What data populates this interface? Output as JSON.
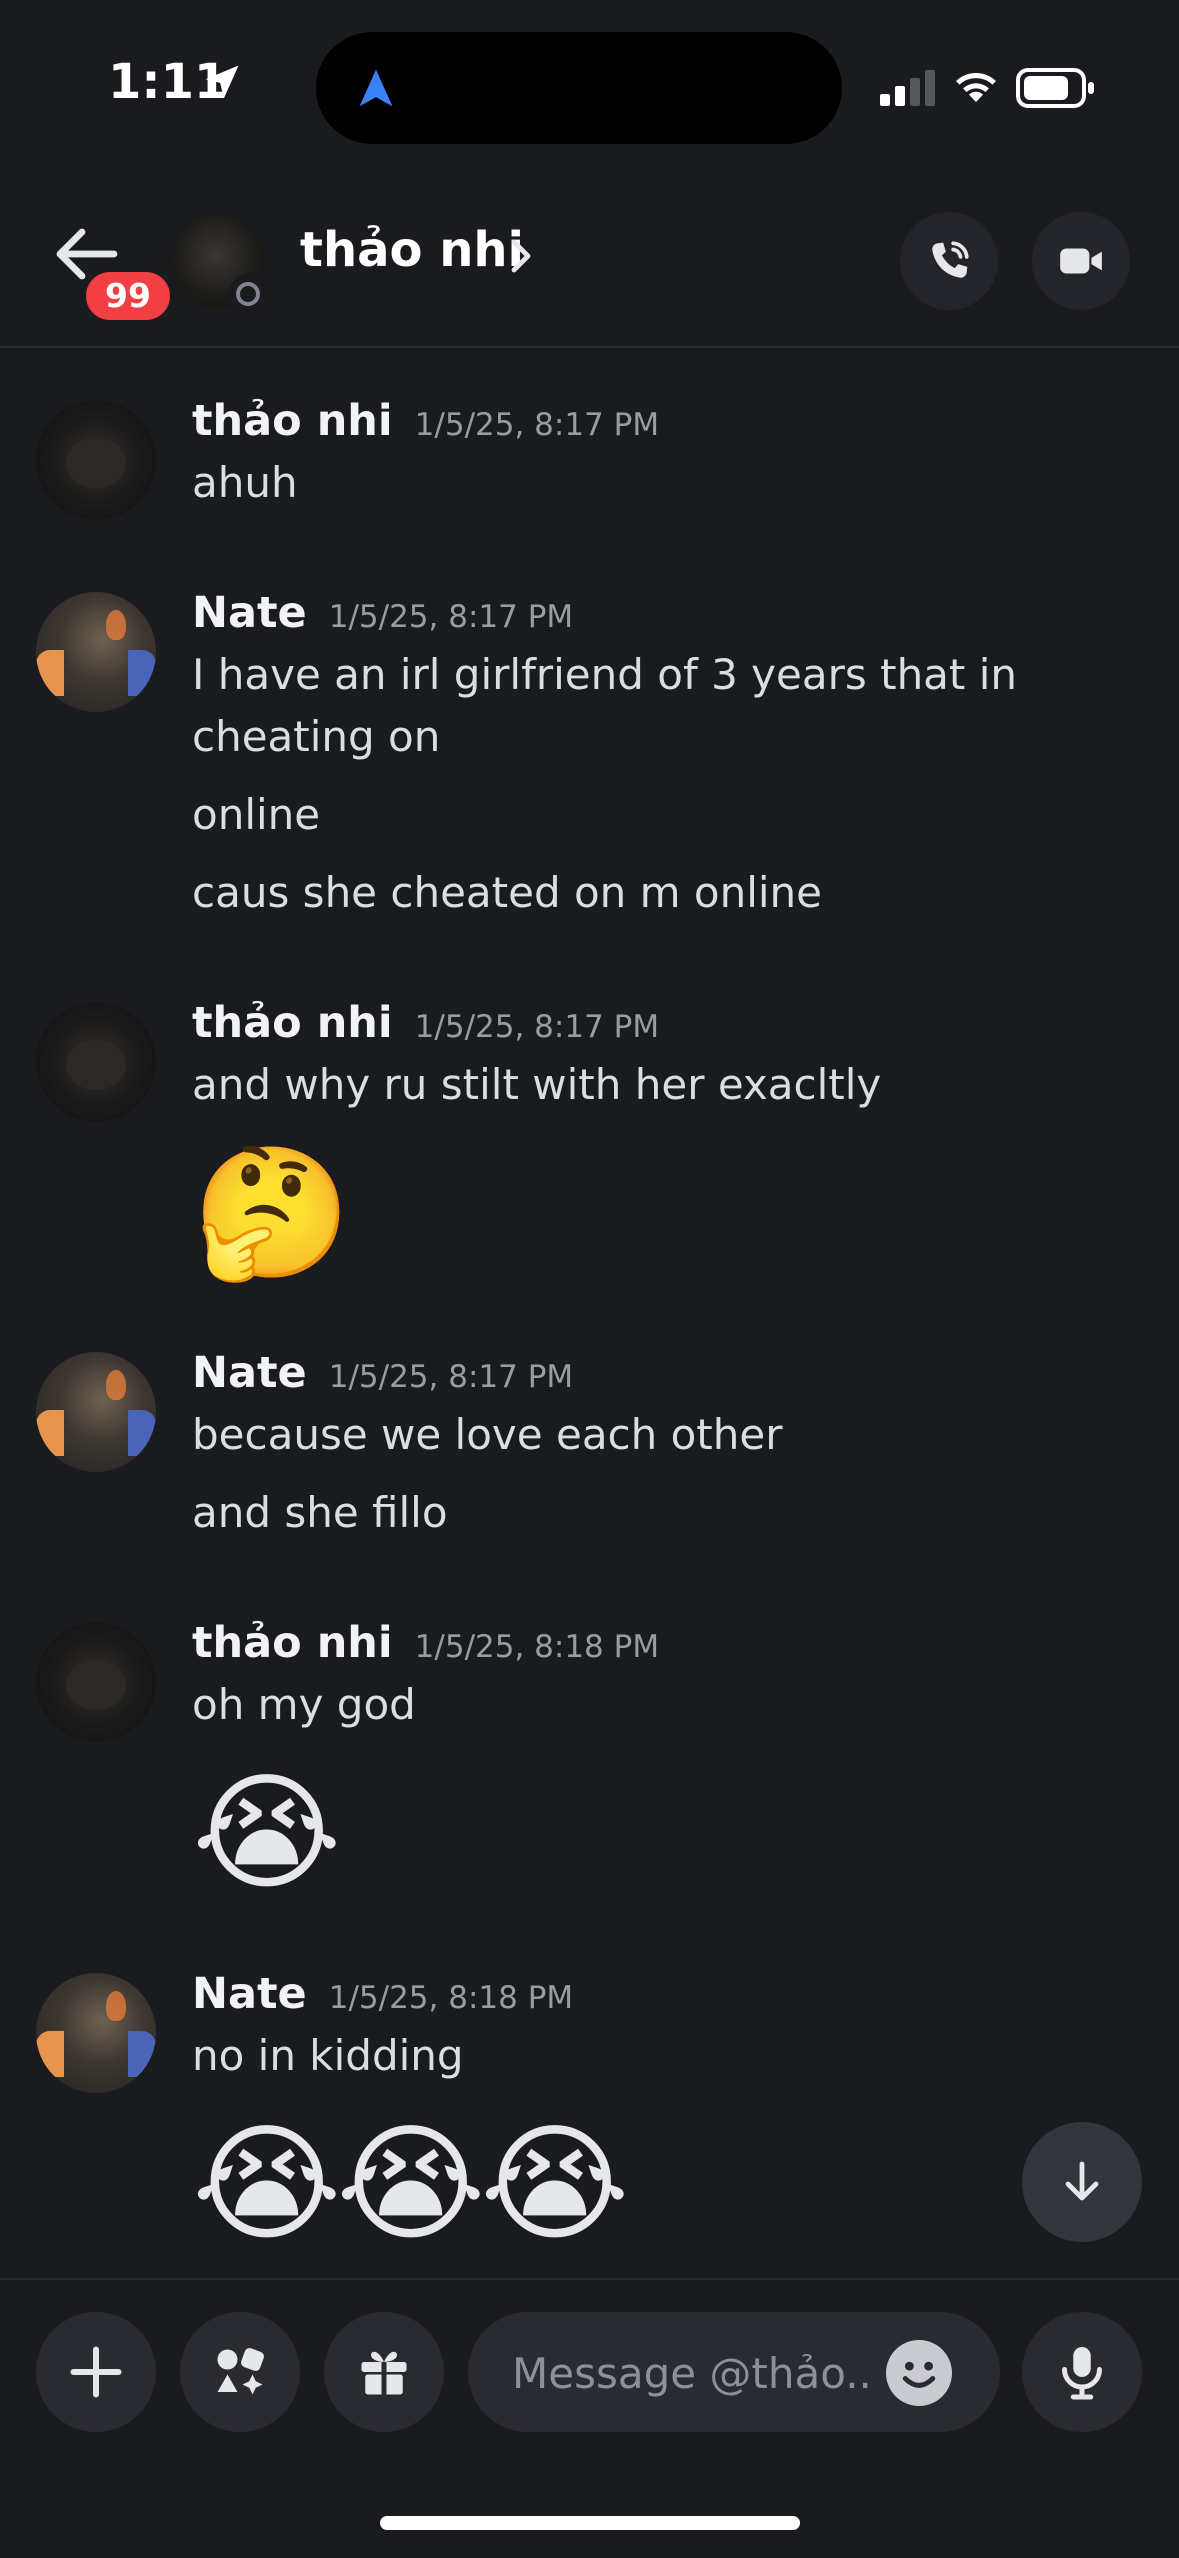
{
  "status_bar": {
    "time": "1:11"
  },
  "header": {
    "back_badge": "99",
    "title": "thảo nhi"
  },
  "messages": [
    {
      "author": "thảo nhi",
      "timestamp": "1/5/25, 8:17 PM",
      "lines": [
        "ahuh"
      ],
      "emoji": []
    },
    {
      "author": "Nate",
      "timestamp": "1/5/25, 8:17 PM",
      "lines": [
        "I have an irl girlfriend of 3 years that in",
        "cheating on",
        "online",
        "caus she cheated on m online"
      ],
      "emoji": []
    },
    {
      "author": "thảo nhi",
      "timestamp": "1/5/25, 8:17 PM",
      "lines": [
        "and why ru stilt with her exacltly"
      ],
      "emoji": [
        "🤔"
      ]
    },
    {
      "author": "Nate",
      "timestamp": "1/5/25, 8:17 PM",
      "lines": [
        "because we love each other",
        "and she fillo"
      ],
      "emoji": []
    },
    {
      "author": "thảo nhi",
      "timestamp": "1/5/25, 8:18 PM",
      "lines": [
        "oh my god"
      ],
      "emoji": [
        "😭"
      ]
    },
    {
      "author": "Nate",
      "timestamp": "1/5/25, 8:18 PM",
      "lines": [
        "no in kidding"
      ],
      "emoji": [
        "😭",
        "😭",
        "😭"
      ]
    }
  ],
  "composer": {
    "placeholder": "Message @thảo..."
  },
  "colors": {
    "background": "#1a1b1f",
    "badge": "#f23f43",
    "accent_blue": "#4a8cff"
  },
  "icons": [
    "location-arrow-icon",
    "signal-icon",
    "wifi-icon",
    "battery-icon",
    "back-arrow-icon",
    "chevron-right-icon",
    "phone-icon",
    "video-camera-icon",
    "arrow-down-icon",
    "plus-icon",
    "apps-icon",
    "gift-icon",
    "emoji-icon",
    "microphone-icon"
  ]
}
